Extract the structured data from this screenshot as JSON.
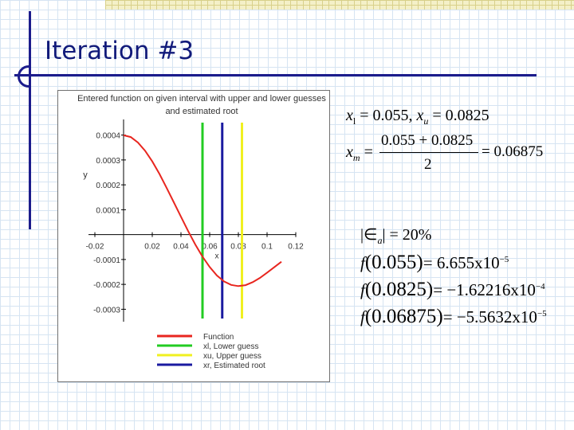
{
  "slide": {
    "title": "Iteration #3"
  },
  "chart_data": {
    "type": "line",
    "title": "Entered function on given interval with upper and lower guesses and estimated root",
    "xlabel": "x",
    "ylabel": "y",
    "xlim": [
      -0.02,
      0.12
    ],
    "ylim": [
      -0.00035,
      0.00045
    ],
    "x_ticks": [
      "-0.02",
      "0.02",
      "0.04",
      "0.06",
      "0.08",
      "0.1",
      "0.12"
    ],
    "y_ticks": [
      "0.0004",
      "0.0003",
      "0.0002",
      "0.0001",
      "-0.0001",
      "-0.0002",
      "-0.0003"
    ],
    "series": [
      {
        "name": "Function",
        "color": "#e8261f",
        "x": [
          0.0,
          0.005,
          0.01,
          0.015,
          0.02,
          0.025,
          0.03,
          0.035,
          0.04,
          0.045,
          0.05,
          0.055,
          0.06,
          0.065,
          0.07,
          0.075,
          0.08,
          0.085,
          0.09,
          0.095,
          0.1,
          0.105,
          0.11
        ],
        "y": [
          0.000399,
          0.000392,
          0.00037,
          0.000337,
          0.000294,
          0.000244,
          0.000188,
          0.00013,
          7.17e-05,
          1.41e-05,
          -3.98e-05,
          -8.85e-05,
          -0.00013,
          -0.000164,
          -0.000188,
          -0.000202,
          -0.000207,
          -0.000203,
          -0.000191,
          -0.000174,
          -0.000153,
          -0.000131,
          -0.000109
        ]
      },
      {
        "name": "xl, Lower guess",
        "color": "#22cc22",
        "x_value": 0.055
      },
      {
        "name": "xu, Upper guess",
        "color": "#f0f020",
        "x_value": 0.0825
      },
      {
        "name": "xr, Estimated root",
        "color": "#1a1aa0",
        "x_value": 0.06875
      }
    ],
    "legend_position": "bottom"
  },
  "equations": {
    "guesses": {
      "xl_var": "x",
      "xl_sub": "l",
      "xl_val": "= 0.055,",
      "xu_var": "x",
      "xu_sub": "u",
      "xu_val": "= 0.0825"
    },
    "midpoint": {
      "lhs_var": "x",
      "lhs_sub": "m",
      "eq1": "=",
      "numerator": "0.055 + 0.0825",
      "denominator": "2",
      "eq2": "= 0.06875"
    },
    "error": {
      "abs_open": "|",
      "eps": "∈",
      "eps_sub": "a",
      "abs_close": "|",
      "val": "= 20%"
    },
    "f_values": [
      {
        "f": "f",
        "arg": "(0.055)",
        "rhs": "= 6.655x10",
        "exp": "−5"
      },
      {
        "f": "f",
        "arg": "(0.0825)",
        "rhs": "= −1.62216x10",
        "exp": "−4"
      },
      {
        "f": "f",
        "arg": "(0.06875)",
        "rhs": "= −5.5632x10",
        "exp": "−5"
      }
    ]
  }
}
